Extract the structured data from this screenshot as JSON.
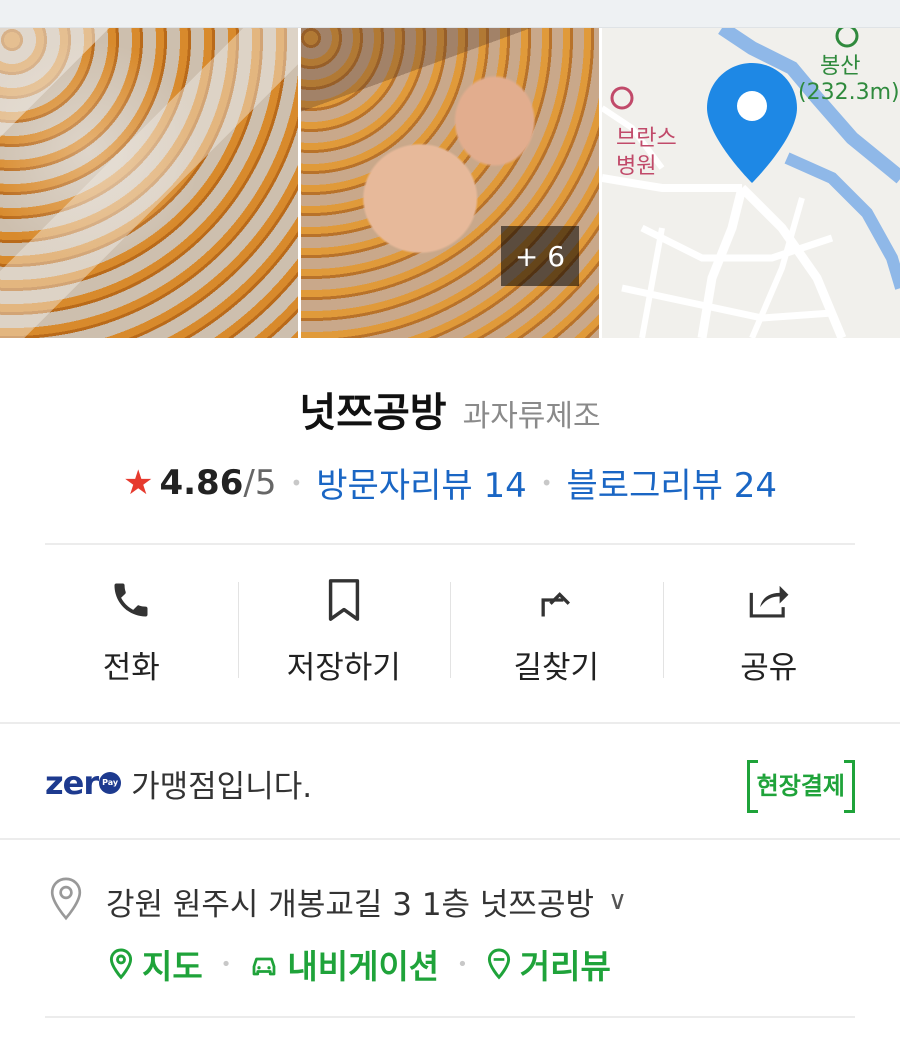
{
  "gallery": {
    "more_badge": "+ 6"
  },
  "map": {
    "peak_name": "봉산",
    "peak_height": "(232.3m)",
    "poi_line1": "브란스",
    "poi_line2": "병원"
  },
  "place": {
    "name": "넛쯔공방",
    "category": "과자류제조"
  },
  "rating": {
    "star": "★",
    "score": "4.86",
    "max": "/5",
    "visitor_reviews": "방문자리뷰 14",
    "blog_reviews": "블로그리뷰 24"
  },
  "actions": [
    {
      "label": "전화",
      "icon": "phone-icon"
    },
    {
      "label": "저장하기",
      "icon": "bookmark-icon"
    },
    {
      "label": "길찾기",
      "icon": "directions-icon"
    },
    {
      "label": "공유",
      "icon": "share-icon"
    }
  ],
  "zeropay": {
    "logo": "zer",
    "logo_o": "Pay",
    "text": "가맹점입니다.",
    "badge": "현장결제"
  },
  "address": {
    "text": "강원 원주시 개봉교길 3 1층 넛쯔공방",
    "chevron": "∨"
  },
  "links": [
    {
      "label": "지도",
      "icon": "map-pin-icon"
    },
    {
      "label": "내비게이션",
      "icon": "car-icon"
    },
    {
      "label": "거리뷰",
      "icon": "streetview-icon"
    }
  ],
  "colors": {
    "accent_green": "#1fa33a",
    "link_blue": "#1a66c4",
    "star_red": "#e63a2e",
    "map_pin": "#1e88e5"
  }
}
